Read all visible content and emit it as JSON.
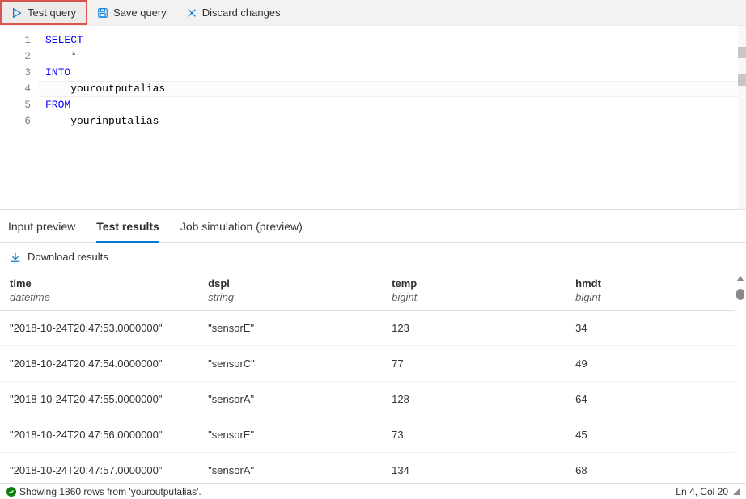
{
  "toolbar": {
    "test": "Test query",
    "save": "Save query",
    "discard": "Discard changes"
  },
  "editor": {
    "lines": [
      {
        "tokens": [
          [
            "kw",
            "SELECT"
          ]
        ]
      },
      {
        "tokens": [
          [
            "plain",
            "    *"
          ]
        ]
      },
      {
        "tokens": [
          [
            "kw",
            "INTO"
          ]
        ]
      },
      {
        "tokens": [
          [
            "plain",
            "    youroutputalias"
          ]
        ]
      },
      {
        "tokens": [
          [
            "kw",
            "FROM"
          ]
        ]
      },
      {
        "tokens": [
          [
            "plain",
            "    yourinputalias"
          ]
        ]
      }
    ],
    "current_line_index": 3
  },
  "tabs": {
    "input_preview": "Input preview",
    "test_results": "Test results",
    "job_simulation": "Job simulation (preview)",
    "active": "test_results"
  },
  "download": {
    "label": "Download results"
  },
  "table": {
    "columns": [
      {
        "name": "time",
        "type": "datetime"
      },
      {
        "name": "dspl",
        "type": "string"
      },
      {
        "name": "temp",
        "type": "bigint"
      },
      {
        "name": "hmdt",
        "type": "bigint"
      }
    ],
    "rows": [
      {
        "time": "\"2018-10-24T20:47:53.0000000\"",
        "dspl": "\"sensorE\"",
        "temp": "123",
        "hmdt": "34"
      },
      {
        "time": "\"2018-10-24T20:47:54.0000000\"",
        "dspl": "\"sensorC\"",
        "temp": "77",
        "hmdt": "49"
      },
      {
        "time": "\"2018-10-24T20:47:55.0000000\"",
        "dspl": "\"sensorA\"",
        "temp": "128",
        "hmdt": "64"
      },
      {
        "time": "\"2018-10-24T20:47:56.0000000\"",
        "dspl": "\"sensorE\"",
        "temp": "73",
        "hmdt": "45"
      },
      {
        "time": "\"2018-10-24T20:47:57.0000000\"",
        "dspl": "\"sensorA\"",
        "temp": "134",
        "hmdt": "68"
      }
    ]
  },
  "status": {
    "message": "Showing 1860 rows from 'youroutputalias'.",
    "cursor": "Ln 4, Col 20"
  }
}
